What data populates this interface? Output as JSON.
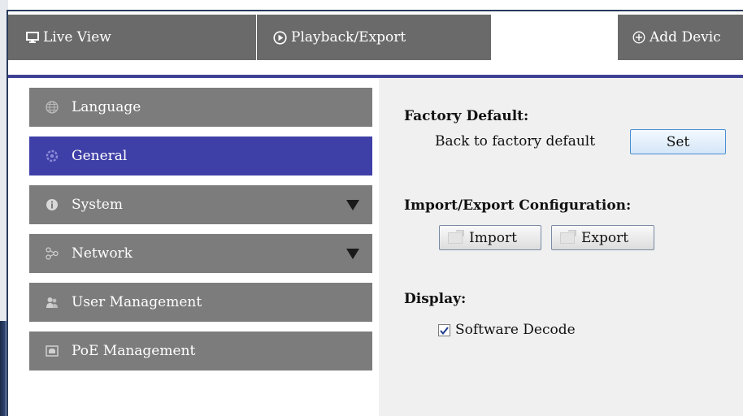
{
  "tabs": [
    {
      "label": "Live View",
      "icon": "monitor-icon"
    },
    {
      "label": "Playback/Export",
      "icon": "play-circle-icon"
    },
    {
      "label": "Add Devic",
      "icon": "plus-circle-icon"
    }
  ],
  "sidebar": {
    "items": [
      {
        "label": "Language",
        "icon": "globe-icon",
        "active": false,
        "expandable": false
      },
      {
        "label": "General",
        "icon": "gear-icon",
        "active": true,
        "expandable": false
      },
      {
        "label": "System",
        "icon": "info-icon",
        "active": false,
        "expandable": true
      },
      {
        "label": "Network",
        "icon": "network-icon",
        "active": false,
        "expandable": true
      },
      {
        "label": "User Management",
        "icon": "users-icon",
        "active": false,
        "expandable": false
      },
      {
        "label": "PoE Management",
        "icon": "poe-icon",
        "active": false,
        "expandable": false
      }
    ]
  },
  "content": {
    "factory": {
      "heading": "Factory Default:",
      "label": "Back to factory default",
      "button": "Set"
    },
    "importexport": {
      "heading": "Import/Export Configuration:",
      "import_button": "Import",
      "export_button": "Export"
    },
    "display": {
      "heading": "Display:",
      "checkbox_label": "Software Decode",
      "checked": true
    }
  },
  "colors": {
    "active_item": "#3f3fa8",
    "tab_bg": "#6a6a6a",
    "item_bg": "#7c7c7c",
    "accent_line": "#3f4294"
  }
}
